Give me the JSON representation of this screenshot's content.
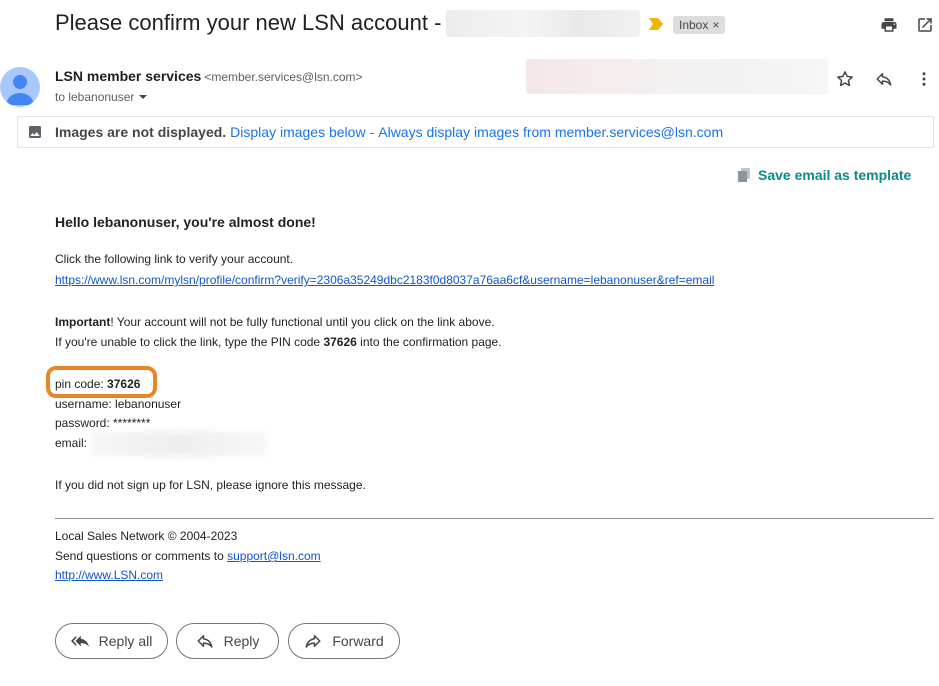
{
  "header": {
    "subject": "Please confirm your new LSN account -",
    "label_chip": "Inbox",
    "chip_close": "×"
  },
  "sender": {
    "name": "LSN member services",
    "email": "<member.services@lsn.com>",
    "to": "to lebanonuser"
  },
  "images_bar": {
    "title": "Images are not displayed.",
    "display_link": "Display images below",
    "separator": "-",
    "always_link": "Always display images from member.services@lsn.com"
  },
  "save_template": "Save email as template",
  "message": {
    "greeting": "Hello lebanonuser, you're almost done!",
    "line1": "Click the following link to verify your account.",
    "verify_link": "https://www.lsn.com/mylsn/profile/confirm?verify=2306a35249dbc2183f0d8037a76aa6cf&username=lebanonuser&ref=email",
    "important_label": "Important",
    "important_rest": "! Your account will not be fully functional until you click on the link above.",
    "pin_line_pre": "If you're unable to click the link, type the PIN code ",
    "pin_value": "37626",
    "pin_line_post": " into the confirmation page.",
    "pin_label": "pin code: ",
    "username_line": "username: lebanonuser",
    "password_line": "password: ********",
    "email_label": "email:",
    "ignore_line": "If you did not sign up for LSN, please ignore this message."
  },
  "footer": {
    "company": "Local Sales Network © 2004-2023",
    "questions_pre": "Send questions or comments to ",
    "support_email": "support@lsn.com",
    "website": "http://www.LSN.com"
  },
  "actions": {
    "reply_all": "Reply all",
    "reply": "Reply",
    "forward": "Forward"
  },
  "colors": {
    "accent_link": "#1a73e8",
    "body_link": "#1155cc",
    "highlight": "#e8862a",
    "template_teal": "#0b8a8a"
  },
  "icons": [
    "important-marker-icon",
    "print-icon",
    "open-new-window-icon",
    "star-icon",
    "reply-icon",
    "more-vert-icon",
    "image-icon",
    "template-icon",
    "reply-all-icon",
    "forward-icon",
    "chevron-down-icon",
    "avatar-person-icon"
  ]
}
